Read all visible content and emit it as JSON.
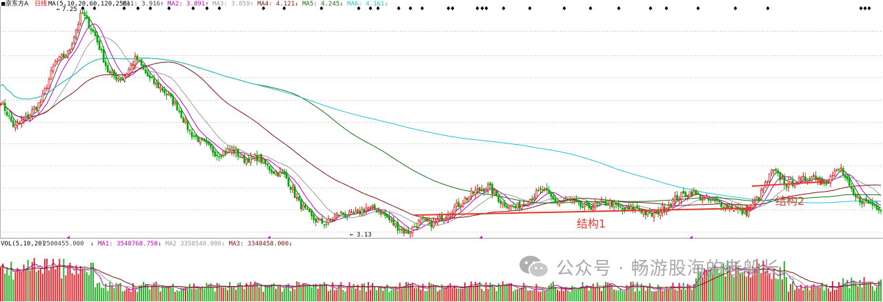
{
  "price_header": {
    "title": "京东方A",
    "period": "日线",
    "ma_params": "MA(5,10,20,60,120,250)",
    "ma_values": [
      {
        "label": "MA1:",
        "value": "3.916",
        "arrow": "↑",
        "color": "#404040"
      },
      {
        "label": "MA2:",
        "value": "3.891",
        "arrow": "↑",
        "color": "#c000c0"
      },
      {
        "label": "MA3:",
        "value": "3.859",
        "arrow": "↑",
        "color": "#9a9a9a"
      },
      {
        "label": "MA4:",
        "value": "4.121",
        "arrow": "↓",
        "color": "#7a1010"
      },
      {
        "label": "MA5:",
        "value": "4.245",
        "arrow": "↓",
        "color": "#107010"
      },
      {
        "label": "MA6:",
        "value": "4.161",
        "arrow": "↓",
        "color": "#20c0d0"
      }
    ]
  },
  "volume_header": {
    "params": "VOL(5,10,20)",
    "vol_value": "2500455.000",
    "vol_arrow": "↓",
    "ma_values": [
      {
        "label": "MA1:",
        "value": "3548768.750",
        "arrow": "↓",
        "color": "#c000c0"
      },
      {
        "label": "MA2",
        "value": "3358540.000",
        "arrow": "↓",
        "color": "#9a9a9a"
      },
      {
        "label": "MA3:",
        "value": "3348458.000",
        "arrow": "↓",
        "color": "#7a1010"
      }
    ]
  },
  "annotations": {
    "high_label": "7.25",
    "low_label": "3.13",
    "structure1": "结构1",
    "structure2": "结构2"
  },
  "watermark": {
    "text": "公众号 · 畅游股海的老船长",
    "icon": "wechat-icon"
  },
  "colors": {
    "up": "#e8000b",
    "down": "#00a800",
    "arrow": "#e03a2a",
    "marker": "#000000",
    "period_marker": "#c000c0",
    "grid": "#b0b0b0",
    "watermark": "#a9a9a9"
  },
  "chart_data": {
    "type": "line",
    "series": [
      {
        "values": [
          5.6,
          5.1,
          5.3,
          5.6,
          6.3,
          6.5,
          7.25,
          6.8,
          6.1,
          6.0,
          6.4,
          6.0,
          5.8,
          5.5,
          5.0,
          4.8,
          4.6,
          4.7,
          4.5,
          4.55,
          4.3,
          4.2,
          3.7,
          3.4,
          3.3,
          3.5,
          3.45,
          3.6,
          3.55,
          3.3,
          3.13,
          3.35,
          3.3,
          3.5,
          3.7,
          3.9,
          4.0,
          3.7,
          3.6,
          3.75,
          3.95,
          3.7,
          3.75,
          3.6,
          3.65,
          3.7,
          3.55,
          3.6,
          3.45,
          3.6,
          3.8,
          3.9,
          3.75,
          3.7,
          3.6,
          3.5,
          3.8,
          4.3,
          4.05,
          4.1,
          4.2,
          4.1,
          4.35,
          3.8,
          3.7,
          3.6
        ]
      }
    ],
    "annotations": [
      "7.25",
      "3.13",
      "结构1",
      "结构2"
    ]
  }
}
